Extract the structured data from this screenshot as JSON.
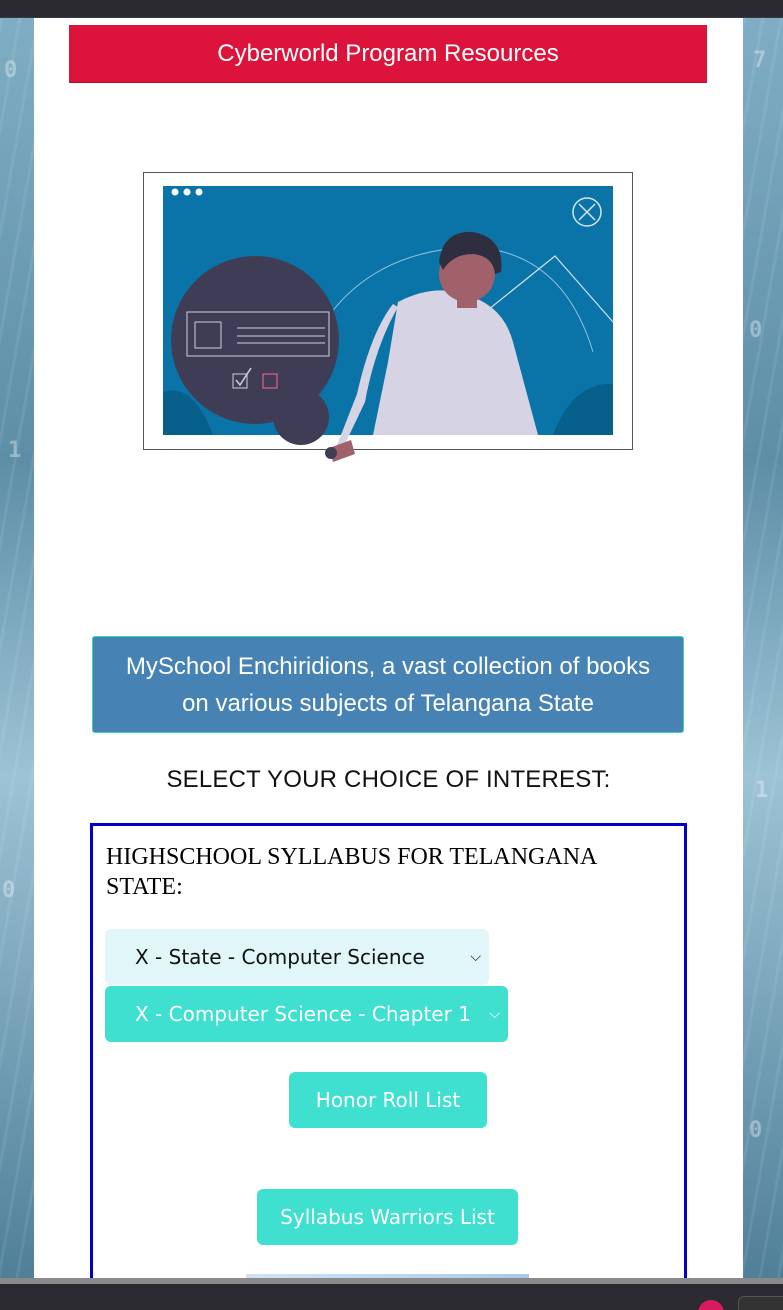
{
  "banner": {
    "title": "Cyberworld Program Resources"
  },
  "collection": {
    "label": "MySchool Enchiridions, a vast collection of books on various subjects of Telangana State"
  },
  "select_heading": "SELECT YOUR CHOICE OF INTEREST:",
  "syllabus": {
    "title": "HIGHSCHOOL SYLLABUS FOR TELANGANA STATE:",
    "state_select": {
      "value": "X - State - Computer Science"
    },
    "chapter_select": {
      "value": "X - Computer Science - Chapter 1"
    },
    "honor_roll_label": "Honor Roll List",
    "warriors_label": "Syllabus Warriors List"
  },
  "colors": {
    "banner_red": "#dc143c",
    "collection_blue": "#4682b4",
    "teal": "#40e0d0",
    "box_border": "#0000cd"
  },
  "icons": {
    "hero": "presentation-illustration",
    "close": "close-circle-icon",
    "select_chevron": "chevron-down-icon"
  }
}
